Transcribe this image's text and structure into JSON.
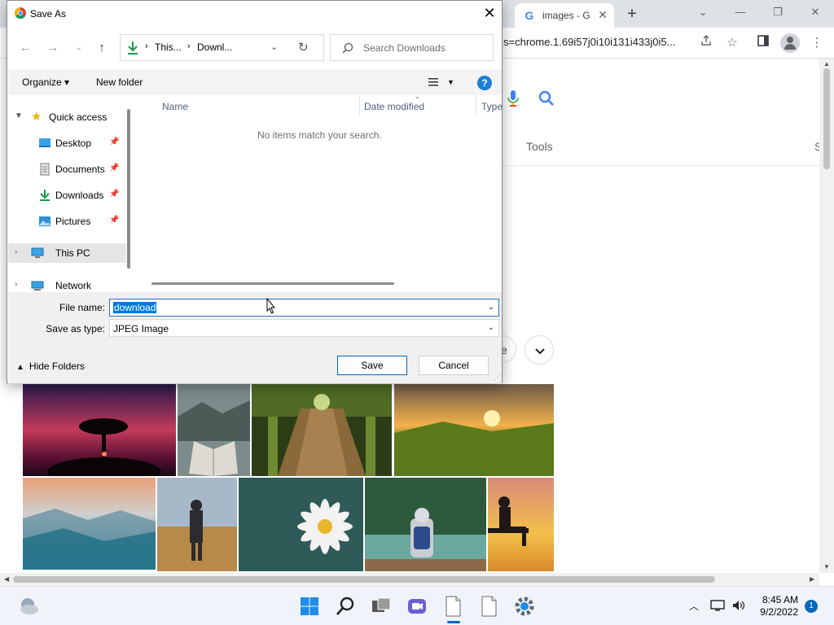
{
  "browser": {
    "tab": {
      "title": "images - G",
      "close": "✕"
    },
    "new_tab": "+",
    "window_controls": {
      "list": "⌄",
      "minimize": "—",
      "restore": "❐",
      "close": "✕"
    },
    "url": "s=chrome.1.69i57j0i10i131i433j0i5...",
    "page": {
      "tools_label": "Tools",
      "partial_tab": "S",
      "partial_chip": "e"
    }
  },
  "dialog": {
    "title": "Save As",
    "close": "✕",
    "breadcrumbs": [
      "This...",
      "Downl..."
    ],
    "search_placeholder": "Search Downloads",
    "commands": {
      "organize": "Organize ▾",
      "new_folder": "New folder"
    },
    "help": "?",
    "nav": {
      "quick_access": "Quick access",
      "items": [
        {
          "label": "Desktop",
          "icon": "desktop-icon"
        },
        {
          "label": "Documents",
          "icon": "documents-icon"
        },
        {
          "label": "Downloads",
          "icon": "downloads-icon"
        },
        {
          "label": "Pictures",
          "icon": "pictures-icon"
        }
      ],
      "this_pc": "This PC",
      "network": "Network"
    },
    "columns": [
      "Name",
      "Date modified",
      "Type"
    ],
    "empty_message": "No items match your search.",
    "file_name_label": "File name:",
    "file_name_value": "download",
    "save_type_label": "Save as type:",
    "save_type_value": "JPEG Image",
    "hide_folders": "Hide Folders",
    "save_button": "Save",
    "cancel_button": "Cancel"
  },
  "taskbar": {
    "clock_time": "8:45 AM",
    "clock_date": "9/2/2022",
    "notifications": "1",
    "accent": "#0067c0"
  }
}
